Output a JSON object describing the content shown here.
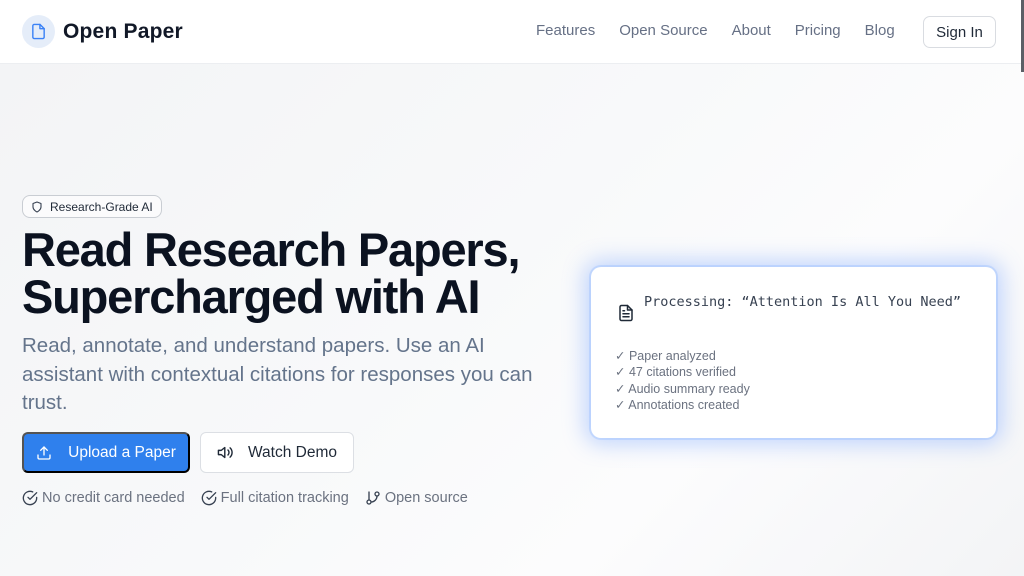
{
  "brand": {
    "name": "Open Paper",
    "logo_icon": "document-icon"
  },
  "nav": {
    "links": [
      "Features",
      "Open Source",
      "About",
      "Pricing",
      "Blog"
    ],
    "signin_label": "Sign In"
  },
  "hero": {
    "badge": {
      "icon": "shield-icon",
      "label": "Research-Grade AI"
    },
    "headline": [
      "Read Research Papers,",
      "Supercharged with AI"
    ],
    "subtitle": "Read, annotate, and understand papers. Use an AI assistant with contextual citations for responses you can trust.",
    "primary_button": {
      "icon": "upload-icon",
      "label": "Upload a Paper"
    },
    "secondary_button": {
      "icon": "speaker-icon",
      "label": "Watch Demo"
    },
    "features": [
      {
        "icon": "check-circle-icon",
        "label": "No credit card needed"
      },
      {
        "icon": "check-circle-icon",
        "label": "Full citation tracking"
      },
      {
        "icon": "git-branch-icon",
        "label": "Open source"
      }
    ]
  },
  "card": {
    "icon": "file-text-icon",
    "title": "Processing: “Attention Is All You Need”",
    "items": [
      "✓ Paper analyzed",
      "✓ 47 citations verified",
      "✓ Audio summary ready",
      "✓ Annotations created"
    ]
  },
  "colors": {
    "primary": "#2f80ed",
    "text_dark": "#0b1220",
    "text_muted": "#64748b",
    "card_glow": "#78a5ff"
  }
}
